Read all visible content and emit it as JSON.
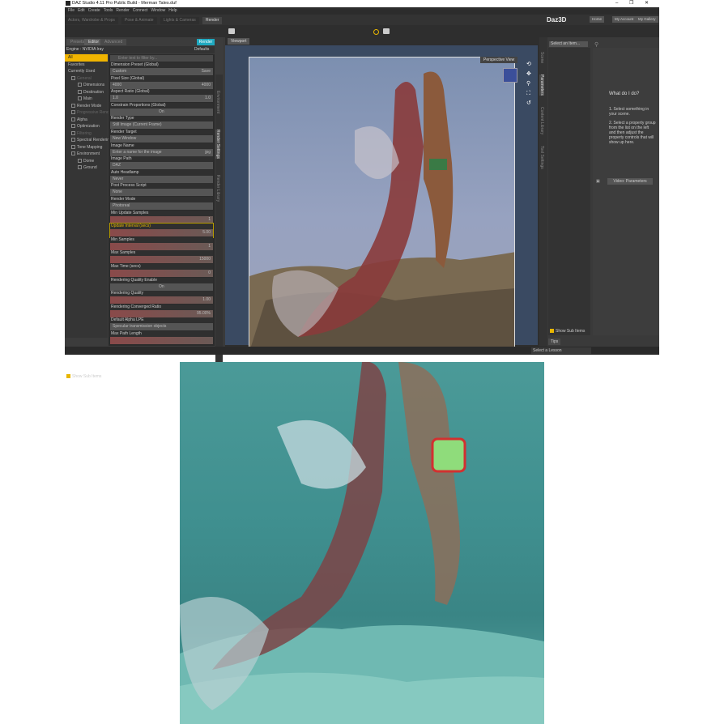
{
  "window": {
    "title": "DAZ Studio 4.11 Pro Public Build - Merman Tales.duf",
    "controls": [
      "–",
      "❐",
      "✕"
    ]
  },
  "menu": [
    "File",
    "Edit",
    "Create",
    "Tools",
    "Render",
    "Connect",
    "Window",
    "Help"
  ],
  "layout_tabs": [
    "Actors, Wardrobe & Props",
    "Pose & Animate",
    "Lights & Cameras",
    "Render"
  ],
  "brand": "Daz3D",
  "top_buttons": [
    "Home",
    "My Account",
    "My Gallery"
  ],
  "render_settings": {
    "tabs": [
      "Presets",
      "Editor",
      "Advanced"
    ],
    "render_button": "Render",
    "engine_label": "Engine :",
    "engine": "NVIDIA Iray",
    "defaults": "Defaults",
    "filter_placeholder": "Enter text to filter by...",
    "categories": [
      {
        "label": "All",
        "kind": "sel"
      },
      {
        "label": "Favorites",
        "kind": ""
      },
      {
        "label": "Currently Used",
        "kind": ""
      },
      {
        "label": "General",
        "kind": "grp dim"
      },
      {
        "label": "Dimensions",
        "kind": "sub"
      },
      {
        "label": "Destination",
        "kind": "sub"
      },
      {
        "label": "Main",
        "kind": "sub"
      },
      {
        "label": "Render Mode",
        "kind": "grp"
      },
      {
        "label": "Progressive Render",
        "kind": "grp dim"
      },
      {
        "label": "Alpha",
        "kind": "grp"
      },
      {
        "label": "Optimization",
        "kind": "grp"
      },
      {
        "label": "Filtering",
        "kind": "grp dim"
      },
      {
        "label": "Spectral Rendering",
        "kind": "grp"
      },
      {
        "label": "Tone Mapping",
        "kind": "grp"
      },
      {
        "label": "Environment",
        "kind": "grp"
      },
      {
        "label": "Dome",
        "kind": "sub"
      },
      {
        "label": "Ground",
        "kind": "sub"
      }
    ],
    "params": [
      {
        "label": "Dimension Preset (Global)",
        "type": "dropdown",
        "value": "Custom",
        "extra": "Save"
      },
      {
        "label": "Pixel Size (Global)",
        "type": "pair",
        "value": "4000",
        "value2": "4000"
      },
      {
        "label": "Aspect Ratio (Global)",
        "type": "pair",
        "value": "1.0",
        "value2": "1.0"
      },
      {
        "label": "Constrain Proportions (Global)",
        "type": "toggle",
        "value": "On"
      },
      {
        "label": "Render Type",
        "type": "dropdown",
        "value": "Still Image (Current Frame)"
      },
      {
        "label": "Render Target",
        "type": "dropdown",
        "value": "New Window"
      },
      {
        "label": "Image Name",
        "type": "dropdown",
        "value": "Enter a name for the image",
        "extra": "jpg"
      },
      {
        "label": "Image Path",
        "type": "dropdown",
        "value": "DAZ"
      },
      {
        "label": "Auto Headlamp",
        "type": "dropdown",
        "value": "Never"
      },
      {
        "label": "Post Process Script",
        "type": "dropdown",
        "value": "None"
      },
      {
        "label": "Render Mode",
        "type": "dropdown",
        "value": "Photoreal"
      },
      {
        "label": "Min Update Samples",
        "type": "slider",
        "value": "1"
      },
      {
        "label": "Update Interval (secs)",
        "type": "slider",
        "value": "5.00",
        "highlight": true
      },
      {
        "label": "Min Samples",
        "type": "slider",
        "value": "1"
      },
      {
        "label": "Max Samples",
        "type": "slider",
        "value": "15000"
      },
      {
        "label": "Max Time (secs)",
        "type": "slider",
        "value": "0"
      },
      {
        "label": "Rendering Quality Enable",
        "type": "toggle",
        "value": "On"
      },
      {
        "label": "Rendering Quality",
        "type": "slider",
        "value": "1.00"
      },
      {
        "label": "Rendering Converged Ratio",
        "type": "slider",
        "value": "95.00%"
      },
      {
        "label": "Default Alpha LPE",
        "type": "dropdown",
        "value": "Specular transmission objects"
      },
      {
        "label": "Max Path Length",
        "type": "slider",
        "value": ""
      }
    ],
    "show_sub_items": "Show Sub Items"
  },
  "side_tabs_left": [
    "Environment",
    "Render Settings",
    "Render Library"
  ],
  "viewport": {
    "tab": "Viewport",
    "view": "Perspective View"
  },
  "side_tabs_right": [
    "Scene",
    "Parameters",
    "Content Library",
    "Tool Settings"
  ],
  "parameters": {
    "select_item": "Select an Item...",
    "help_title": "What do I do?",
    "step1": "1. Select something in your scene.",
    "step2": "2. Select a property group from the list on the left and then adjust the property controls that will show up here.",
    "video": "Video: Parameters",
    "show_sub_items": "Show Sub Items"
  },
  "bottom": {
    "lesson": "Select a Lesson",
    "tips": "Tips"
  }
}
